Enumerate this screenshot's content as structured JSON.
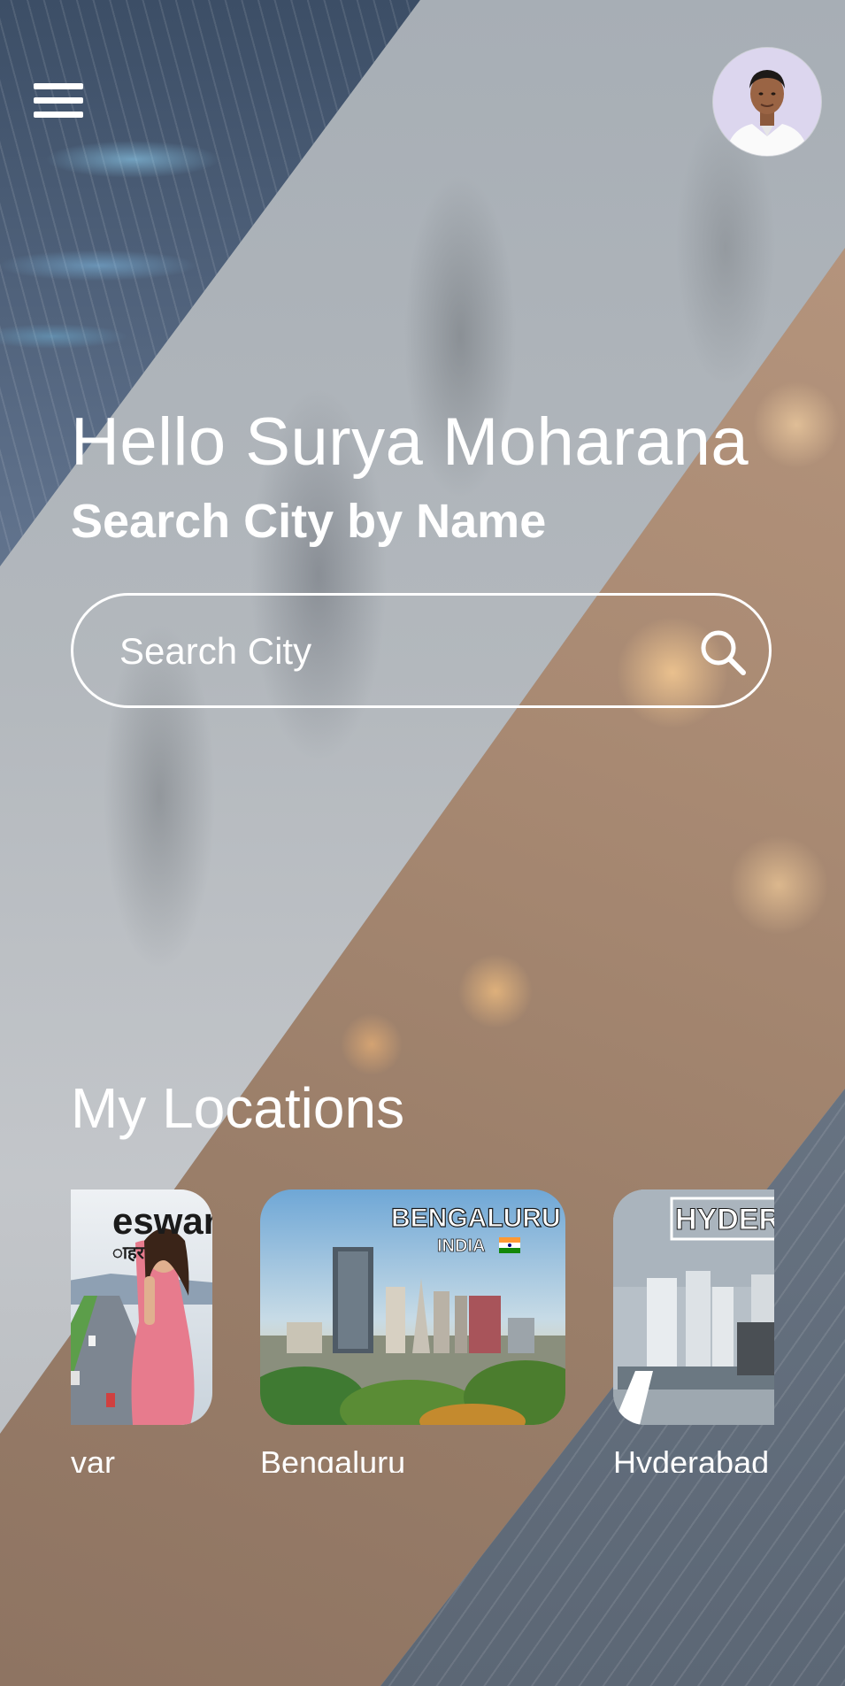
{
  "header": {
    "menu_icon": "hamburger-menu-icon",
    "avatar_icon": "user-avatar"
  },
  "hero": {
    "greeting": "Hello Surya Moharana",
    "subtitle": "Search City by Name"
  },
  "search": {
    "placeholder": "Search City",
    "icon": "search-icon"
  },
  "locations": {
    "title": "My Locations",
    "items": [
      {
        "label": "var",
        "image_text": "eswar",
        "image_subtext": "ाहर"
      },
      {
        "label": "Bengaluru",
        "image_text": "BENGALURU",
        "image_subtext": "INDIA"
      },
      {
        "label": "Hyderabad",
        "image_text": "HYDERA"
      }
    ]
  },
  "colors": {
    "text": "#ffffff",
    "search_border": "#ffffff"
  }
}
